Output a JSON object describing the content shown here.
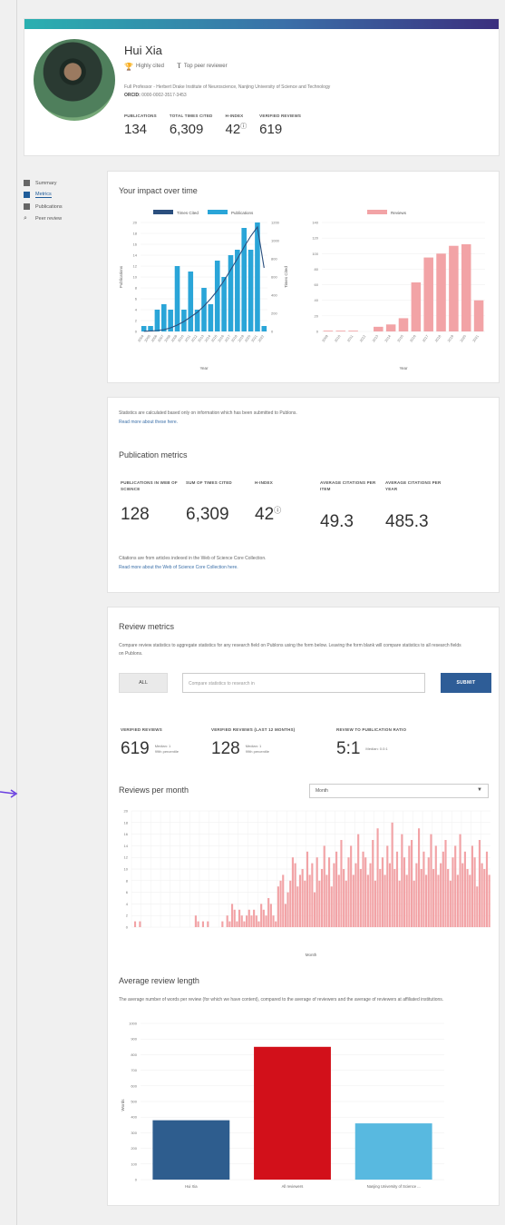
{
  "profile": {
    "name": "Hui Xia",
    "badge1": "Highly cited",
    "badge2": "Top peer reviewer",
    "affiliation": "Full Professor - Herbert Drake Institute of Neuroscience, Nanjing University of Science and Technology",
    "orcid_label": "ORCID:",
    "orcid": "0000-0002-3517-3453",
    "stats": [
      {
        "label": "PUBLICATIONS",
        "value": "134"
      },
      {
        "label": "TOTAL TIMES CITED",
        "value": "6,309"
      },
      {
        "label": "H-INDEX",
        "value": "42"
      },
      {
        "label": "VERIFIED REVIEWS",
        "value": "619"
      }
    ]
  },
  "nav": [
    "Summary",
    "Metrics",
    "Publications",
    "Peer review"
  ],
  "impact": {
    "title": "Your impact over time",
    "left_legend": [
      "Times Cited",
      "Publications"
    ],
    "left_xlabel": "Year",
    "right_legend": "Reviews",
    "right_xlabel": "Year"
  },
  "pubmetrics": {
    "note": "Statistics are calculated based only on information which has been submitted to Publons.",
    "note_link": "Read more about these here.",
    "title": "Publication metrics",
    "metrics": [
      {
        "label": "PUBLICATIONS IN WEB OF SCIENCE",
        "value": "128"
      },
      {
        "label": "SUM OF TIMES CITED",
        "value": "6,309"
      },
      {
        "label": "H-INDEX",
        "value": "42"
      },
      {
        "label": "AVERAGE CITATIONS PER ITEM",
        "value": "49.3"
      },
      {
        "label": "AVERAGE CITATIONS PER YEAR",
        "value": "485.3"
      }
    ],
    "footer": "Citations are from articles indexed in the Web of Science Core Collection.",
    "footer_link": "Read more about the Web of Science Core Collection here."
  },
  "review": {
    "title": "Review metrics",
    "desc": "Compare review statistics to aggregate statistics for any research field on Publons using the form below. Leaving the form blank will compare statistics to all research fields on Publons.",
    "all_button": "ALL",
    "input_placeholder": "Compare statistics to research in",
    "submit": "SUBMIT",
    "stats": [
      {
        "label": "VERIFIED REVIEWS",
        "value": "619",
        "sub1": "Median: 1",
        "sub2": "99th percentile"
      },
      {
        "label": "VERIFIED REVIEWS (LAST 12 MONTHS)",
        "value": "128",
        "sub1": "Median: 1",
        "sub2": "99th percentile"
      },
      {
        "label": "REVIEW TO PUBLICATION RATIO",
        "value": "5:1",
        "sub1": "Median: 0.0:1",
        "sub2": ""
      }
    ],
    "per_month_title": "Reviews per month",
    "select_value": "Month",
    "per_month_xlabel": "Month",
    "avg_title": "Average review length",
    "avg_desc": "The average number of words per review (for which we have content), compared to the average of reviewers and the average of reviewers at affiliated institutions.",
    "avg_ylabel": "Words"
  },
  "chart_data": [
    {
      "type": "bar",
      "title": "",
      "series": [
        {
          "name": "Publications",
          "values": [
            1,
            1,
            4,
            5,
            4,
            12,
            4,
            11,
            4,
            8,
            5,
            13,
            10,
            14,
            15,
            19,
            15,
            20,
            1
          ]
        },
        {
          "name": "Times Cited",
          "values": [
            2,
            5,
            10,
            20,
            40,
            70,
            110,
            160,
            210,
            280,
            360,
            450,
            560,
            680,
            800,
            930,
            1050,
            1150,
            700
          ]
        }
      ],
      "categories": [
        "2004",
        "2005",
        "2006",
        "2007",
        "2008",
        "2009",
        "2010",
        "2011",
        "2012",
        "2013",
        "2014",
        "2015",
        "2016",
        "2017",
        "2018",
        "2019",
        "2020",
        "2021",
        "2022"
      ],
      "xlabel": "Year",
      "ylabel": "Publications",
      "ylabel2": "Times Cited",
      "ylim": [
        0,
        20
      ],
      "ylim2": [
        0,
        1200
      ]
    },
    {
      "type": "bar",
      "series": [
        {
          "name": "Reviews",
          "values": [
            1,
            1,
            1,
            0,
            6,
            9,
            17,
            63,
            95,
            100,
            110,
            112,
            40
          ]
        }
      ],
      "categories": [
        "2009",
        "2010",
        "2011",
        "2012",
        "2013",
        "2014",
        "2015",
        "2016",
        "2017",
        "2018",
        "2019",
        "2020",
        "2021"
      ],
      "xlabel": "Year",
      "ylim": [
        0,
        140
      ]
    },
    {
      "type": "bar",
      "series": [
        {
          "name": "Reviews",
          "values": [
            0,
            1,
            0,
            1,
            0,
            0,
            0,
            0,
            0,
            0,
            0,
            0,
            0,
            0,
            0,
            0,
            0,
            0,
            0,
            0,
            0,
            0,
            0,
            0,
            0,
            0,
            2,
            1,
            0,
            1,
            0,
            1,
            0,
            0,
            0,
            0,
            0,
            1,
            0,
            2,
            1,
            4,
            3,
            1,
            3,
            2,
            1,
            2,
            3,
            2,
            3,
            2,
            1,
            4,
            3,
            2,
            5,
            4,
            2,
            1,
            7,
            8,
            9,
            4,
            6,
            8,
            12,
            11,
            7,
            9,
            10,
            8,
            13,
            9,
            11,
            6,
            12,
            8,
            10,
            14,
            9,
            12,
            7,
            11,
            13,
            9,
            15,
            10,
            8,
            12,
            14,
            9,
            11,
            16,
            10,
            13,
            12,
            9,
            11,
            15,
            8,
            17,
            10,
            12,
            9,
            14,
            11,
            18,
            10,
            13,
            8,
            16,
            12,
            9,
            14,
            15,
            8,
            11,
            17,
            10,
            13,
            9,
            12,
            16,
            10,
            14,
            9,
            11,
            13,
            15,
            10,
            8,
            12,
            14,
            9,
            16,
            11,
            13,
            10,
            9,
            14,
            12,
            7,
            15,
            11,
            10,
            13,
            9
          ]
        }
      ],
      "xlabel": "Month",
      "ylim": [
        0,
        20
      ]
    },
    {
      "type": "bar",
      "categories": [
        "Hui Xia",
        "All reviewers",
        "Nanjing University of Science ..."
      ],
      "values": [
        380,
        850,
        360
      ],
      "ylabel": "Words",
      "ylim": [
        0,
        1000
      ]
    }
  ]
}
